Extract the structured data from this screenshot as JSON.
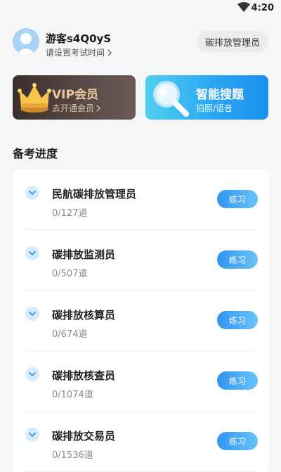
{
  "status_bar": {
    "time": "4:20"
  },
  "profile": {
    "username": "游客s4Q0yS",
    "subtitle": "请设置考试时间",
    "role_button": "碳排放管理员"
  },
  "vip_card": {
    "title": "VIP会员",
    "subtitle": "去开通会员"
  },
  "search_card": {
    "title": "智能搜题",
    "subtitle": "拍照/语音"
  },
  "section": {
    "title": "备考进度"
  },
  "courses": [
    {
      "name": "民航碳排放管理员",
      "progress": "0/127道",
      "button": "练习"
    },
    {
      "name": "碳排放监测员",
      "progress": "0/507道",
      "button": "练习"
    },
    {
      "name": "碳排放核算员",
      "progress": "0/674道",
      "button": "练习"
    },
    {
      "name": "碳排放核查员",
      "progress": "0/1074道",
      "button": "练习"
    },
    {
      "name": "碳排放交易员",
      "progress": "0/1536道",
      "button": "练习"
    }
  ],
  "colors": {
    "accent_blue": "#2f95f2",
    "vip_gold": "#ecc7a0",
    "vip_bg": "#3a2f2c"
  }
}
